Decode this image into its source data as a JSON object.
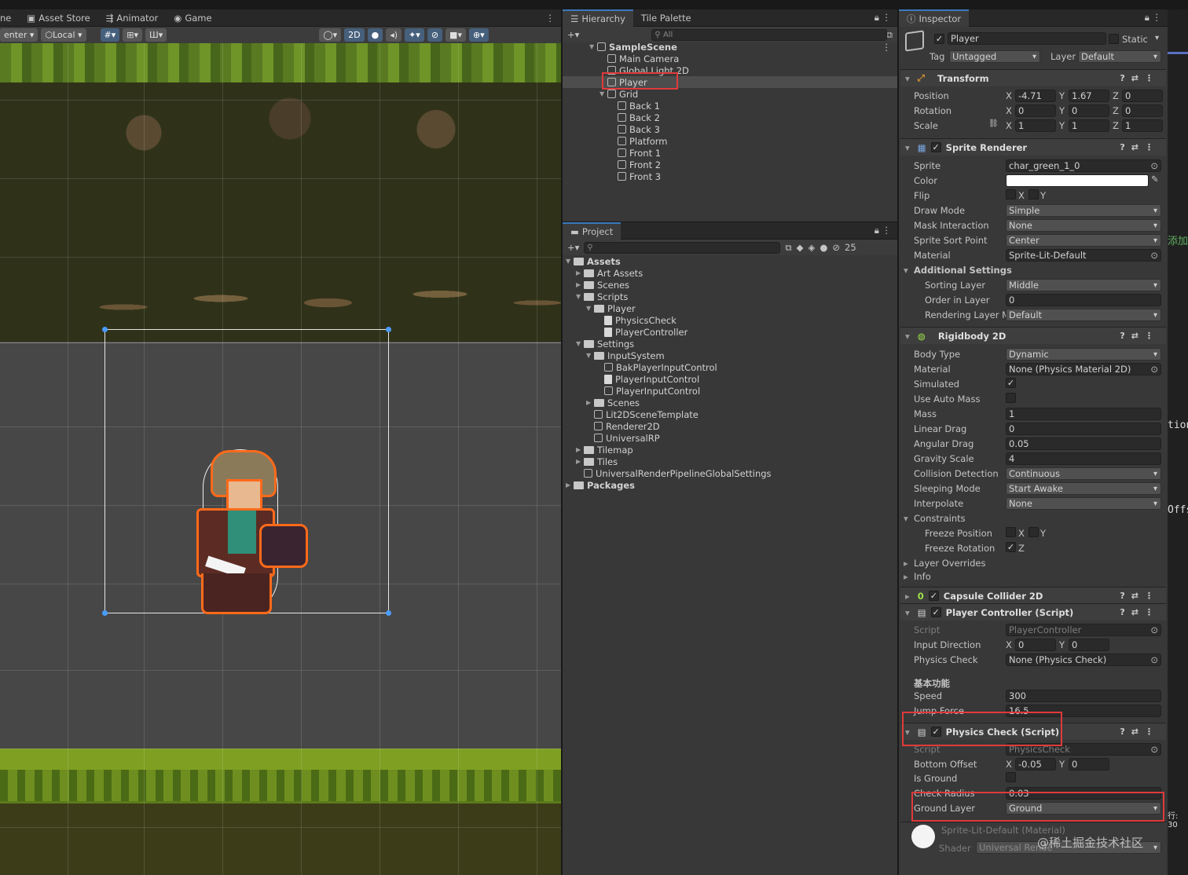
{
  "scene_tabs": [
    "ne",
    "Asset Store",
    "Animator",
    "Game"
  ],
  "scene_toolbar": {
    "pivot": "enter",
    "space": "Local",
    "mode_2d": "2D"
  },
  "hierarchy": {
    "tabs": [
      "Hierarchy",
      "Tile Palette"
    ],
    "search_placeholder": "All",
    "items": [
      {
        "label": "SampleScene",
        "depth": 0,
        "kind": "scene"
      },
      {
        "label": "Main Camera",
        "depth": 1
      },
      {
        "label": "Global Light 2D",
        "depth": 1
      },
      {
        "label": "Player",
        "depth": 1
      },
      {
        "label": "Grid",
        "depth": 1
      },
      {
        "label": "Back 1",
        "depth": 2
      },
      {
        "label": "Back 2",
        "depth": 2
      },
      {
        "label": "Back 3",
        "depth": 2
      },
      {
        "label": "Platform",
        "depth": 2
      },
      {
        "label": "Front 1",
        "depth": 2
      },
      {
        "label": "Front 2",
        "depth": 2
      },
      {
        "label": "Front 3",
        "depth": 2
      }
    ]
  },
  "project": {
    "tab": "Project",
    "count": "25",
    "items": [
      {
        "label": "Assets",
        "depth": 0,
        "kind": "folder",
        "open": true
      },
      {
        "label": "Art Assets",
        "depth": 1,
        "kind": "folder"
      },
      {
        "label": "Scenes",
        "depth": 1,
        "kind": "folder"
      },
      {
        "label": "Scripts",
        "depth": 1,
        "kind": "folder",
        "open": true
      },
      {
        "label": "Player",
        "depth": 2,
        "kind": "folder",
        "open": true
      },
      {
        "label": "PhysicsCheck",
        "depth": 3,
        "kind": "script"
      },
      {
        "label": "PlayerController",
        "depth": 3,
        "kind": "script"
      },
      {
        "label": "Settings",
        "depth": 1,
        "kind": "folder",
        "open": true
      },
      {
        "label": "InputSystem",
        "depth": 2,
        "kind": "folder",
        "open": true
      },
      {
        "label": "BakPlayerInputControl",
        "depth": 3,
        "kind": "asset"
      },
      {
        "label": "PlayerInputControl",
        "depth": 3,
        "kind": "script"
      },
      {
        "label": "PlayerInputControl",
        "depth": 3,
        "kind": "asset"
      },
      {
        "label": "Scenes",
        "depth": 2,
        "kind": "folder"
      },
      {
        "label": "Lit2DSceneTemplate",
        "depth": 2,
        "kind": "asset"
      },
      {
        "label": "Renderer2D",
        "depth": 2,
        "kind": "asset"
      },
      {
        "label": "UniversalRP",
        "depth": 2,
        "kind": "asset"
      },
      {
        "label": "Tilemap",
        "depth": 1,
        "kind": "folder"
      },
      {
        "label": "Tiles",
        "depth": 1,
        "kind": "folder"
      },
      {
        "label": "UniversalRenderPipelineGlobalSettings",
        "depth": 1,
        "kind": "asset"
      },
      {
        "label": "Packages",
        "depth": 0,
        "kind": "folder"
      }
    ]
  },
  "inspector": {
    "tab": "Inspector",
    "object_name": "Player",
    "static_label": "Static",
    "tag_label": "Tag",
    "tag": "Untagged",
    "layer_label": "Layer",
    "layer": "Default",
    "transform": {
      "title": "Transform",
      "position": {
        "label": "Position",
        "x": "-4.71",
        "y": "1.67",
        "z": "0"
      },
      "rotation": {
        "label": "Rotation",
        "x": "0",
        "y": "0",
        "z": "0"
      },
      "scale": {
        "label": "Scale",
        "x": "1",
        "y": "1",
        "z": "1"
      }
    },
    "sprite_renderer": {
      "title": "Sprite Renderer",
      "sprite_label": "Sprite",
      "sprite": "char_green_1_0",
      "color_label": "Color",
      "flip_label": "Flip",
      "draw_mode_label": "Draw Mode",
      "draw_mode": "Simple",
      "mask_label": "Mask Interaction",
      "mask": "None",
      "sort_point_label": "Sprite Sort Point",
      "sort_point": "Center",
      "material_label": "Material",
      "material": "Sprite-Lit-Default",
      "additional_label": "Additional Settings",
      "sorting_layer_label": "Sorting Layer",
      "sorting_layer": "Middle",
      "order_label": "Order in Layer",
      "order": "0",
      "rendering_layer_label": "Rendering Layer M",
      "rendering_layer": "Default"
    },
    "rigidbody": {
      "title": "Rigidbody 2D",
      "body_type_label": "Body Type",
      "body_type": "Dynamic",
      "material_label": "Material",
      "material": "None (Physics Material 2D)",
      "simulated_label": "Simulated",
      "auto_mass_label": "Use Auto Mass",
      "mass_label": "Mass",
      "mass": "1",
      "linear_drag_label": "Linear Drag",
      "linear_drag": "0",
      "angular_drag_label": "Angular Drag",
      "angular_drag": "0.05",
      "gravity_label": "Gravity Scale",
      "gravity": "4",
      "collision_label": "Collision Detection",
      "collision": "Continuous",
      "sleeping_label": "Sleeping Mode",
      "sleeping": "Start Awake",
      "interpolate_label": "Interpolate",
      "interpolate": "None",
      "constraints_label": "Constraints",
      "freeze_pos_label": "Freeze Position",
      "freeze_rot_label": "Freeze Rotation",
      "layer_overrides_label": "Layer Overrides",
      "info_label": "Info"
    },
    "capsule": {
      "title": "Capsule Collider 2D"
    },
    "player_controller": {
      "title": "Player Controller (Script)",
      "script_label": "Script",
      "script": "PlayerController",
      "input_label": "Input Direction",
      "input_x": "0",
      "input_y": "0",
      "physics_check_label": "Physics Check",
      "physics_check": "None (Physics Check)",
      "header": "基本功能",
      "speed_label": "Speed",
      "speed": "300",
      "jump_label": "Jump Force",
      "jump": "16.5"
    },
    "physics_check": {
      "title": "Physics Check (Script)",
      "script_label": "Script",
      "script": "PhysicsCheck",
      "offset_label": "Bottom Offset",
      "offset_x": "-0.05",
      "offset_y": "0",
      "ground_label": "Is Ground",
      "radius_label": "Check Radius",
      "radius": "0.03",
      "ground_layer_label": "Ground Layer",
      "ground_layer": "Ground"
    },
    "material_preview": {
      "name": "Sprite-Lit-Default (Material)",
      "shader_label": "Shader",
      "shader": "Universal Rende"
    }
  },
  "side_fragments": [
    "添加",
    "tion",
    "Offs",
    "行: 30"
  ],
  "watermark": "@稀土掘金技术社区",
  "colors": {
    "accent": "#3a79bb",
    "highlight": "#e03a3a",
    "selection": "#4d4d4d"
  }
}
